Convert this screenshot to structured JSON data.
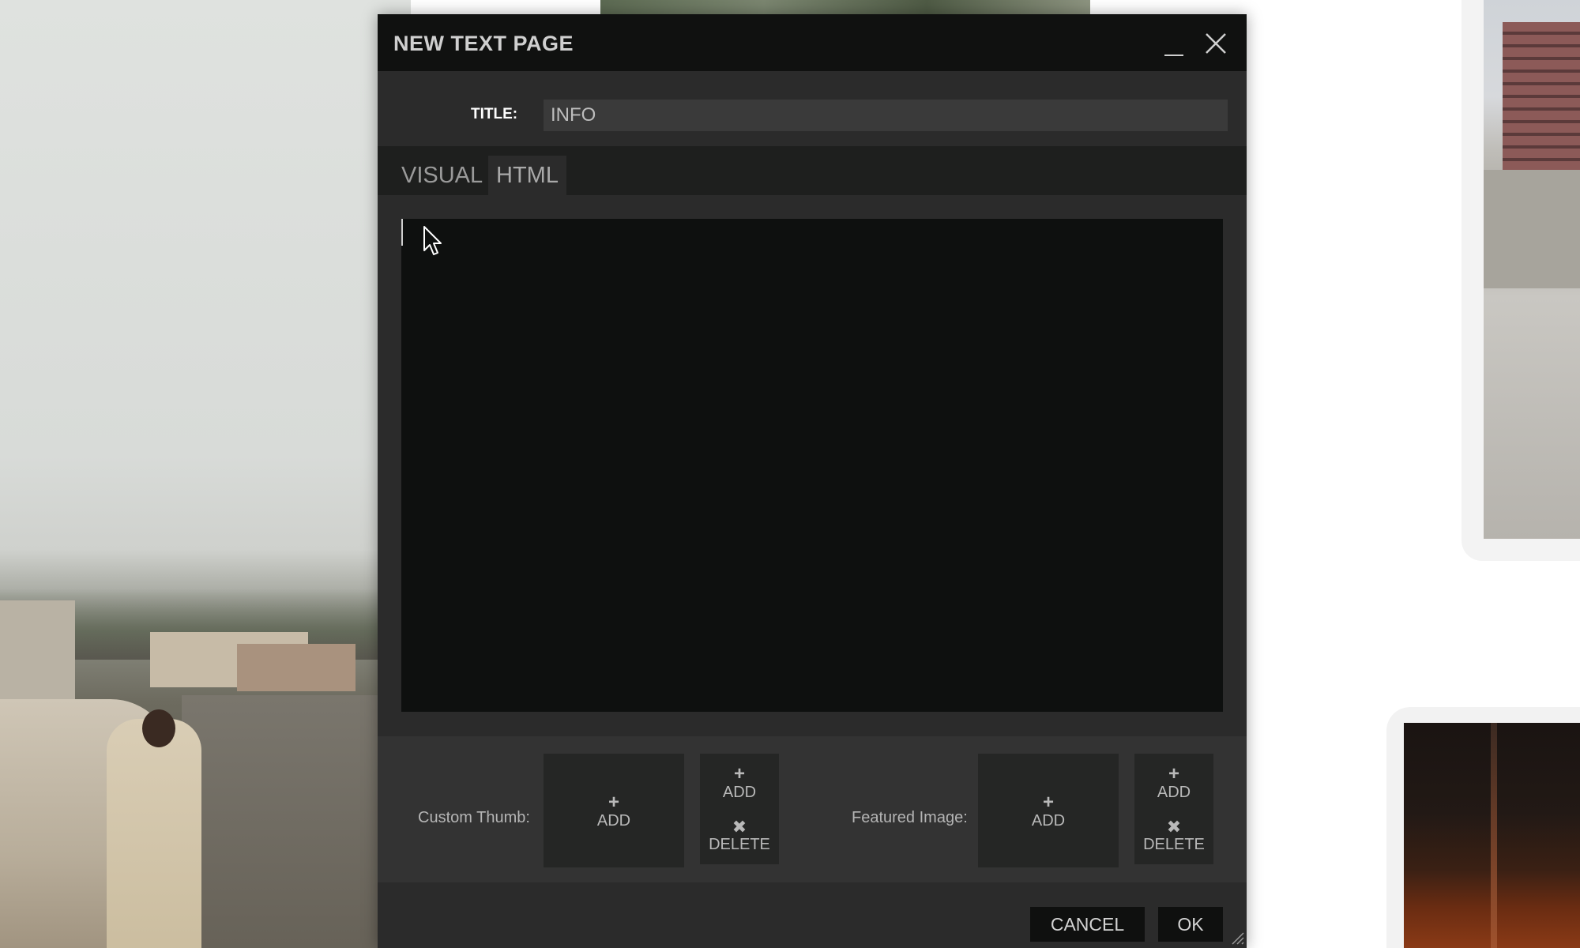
{
  "dialog": {
    "title": "NEW TEXT PAGE",
    "title_label": "TITLE:",
    "title_value": "INFO",
    "tabs": [
      {
        "label": "VISUAL",
        "active": false
      },
      {
        "label": "HTML",
        "active": true
      }
    ],
    "editor_content": "",
    "custom_thumb": {
      "label": "Custom Thumb:",
      "add_label": "ADD",
      "small_add_label": "ADD",
      "delete_label": "DELETE"
    },
    "featured_image": {
      "label": "Featured Image:",
      "add_label": "ADD",
      "small_add_label": "ADD",
      "delete_label": "DELETE"
    },
    "cancel_label": "CANCEL",
    "ok_label": "OK",
    "icons": {
      "minimize": "minimize-icon",
      "close": "close-icon",
      "plus": "plus-icon",
      "delete": "x-icon",
      "resize": "resize-grip-icon"
    }
  },
  "colors": {
    "titlebar_bg": "#101110",
    "dialog_bg": "#2b2b2b",
    "editor_bg": "#0e100f",
    "button_bg": "#0f100f",
    "text_light": "#cfcfcf"
  }
}
